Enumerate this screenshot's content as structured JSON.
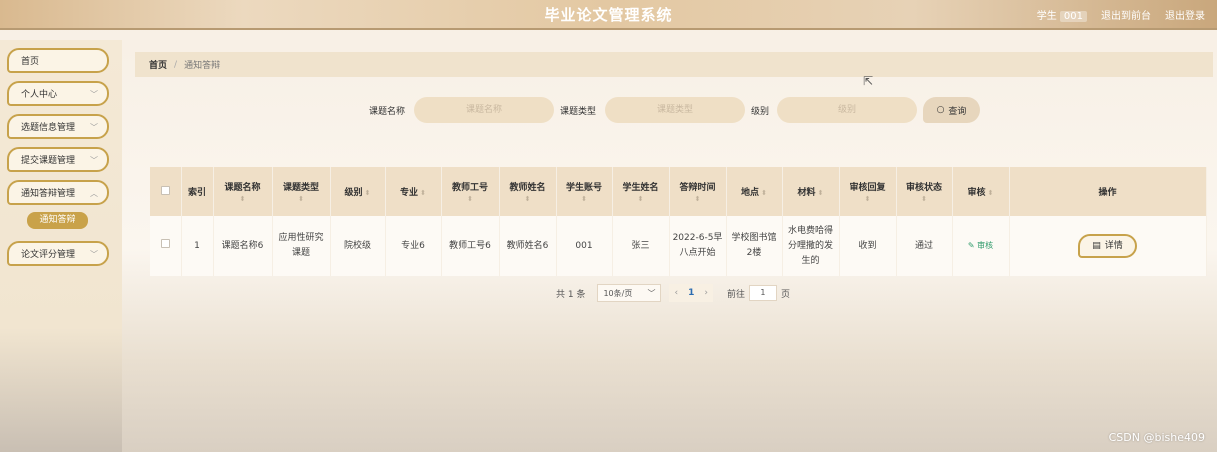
{
  "header": {
    "title": "毕业论文管理系统",
    "user_label": "学生",
    "user_name": "001",
    "to_front": "退出到前台",
    "logout": "退出登录"
  },
  "sidebar": {
    "items": [
      {
        "label": "首页"
      },
      {
        "label": "个人中心"
      },
      {
        "label": "选题信息管理"
      },
      {
        "label": "提交课题管理"
      },
      {
        "label": "通知答辩管理"
      },
      {
        "label": "论文评分管理"
      }
    ],
    "sub_item": "通知答辩"
  },
  "breadcrumb": {
    "home": "首页",
    "sep": "/",
    "current": "通知答辩"
  },
  "search": {
    "topic_label": "课题名称",
    "topic_placeholder": "课题名称",
    "type_label": "课题类型",
    "type_placeholder": "课题类型",
    "level_label": "级别",
    "level_placeholder": "级别",
    "query_btn": "查询"
  },
  "table": {
    "headers": [
      "索引",
      "课题名称",
      "课题类型",
      "级别",
      "专业",
      "教师工号",
      "教师姓名",
      "学生账号",
      "学生姓名",
      "答辩时间",
      "地点",
      "材料",
      "审核回复",
      "审核状态",
      "审核",
      "操作"
    ],
    "rows": [
      {
        "index": "1",
        "topic": "课题名称6",
        "type": "应用性研究课题",
        "level": "院校级",
        "major": "专业6",
        "teacher_id": "教师工号6",
        "teacher_name": "教师姓名6",
        "student_account": "001",
        "student_name": "张三",
        "defense_time": "2022-6-5早八点开始",
        "location": "学校图书馆2楼",
        "material": "水电费哈得分哩撒的发生的",
        "review_reply": "收到",
        "review_status": "通过",
        "audit_action": "审核",
        "detail_btn": "详情"
      }
    ]
  },
  "pagination": {
    "total": "共 1 条",
    "page_size": "10条/页",
    "current_page": "1",
    "goto_label": "前往",
    "goto_value": "1",
    "page_suffix": "页"
  },
  "watermark": "CSDN @bishe409"
}
